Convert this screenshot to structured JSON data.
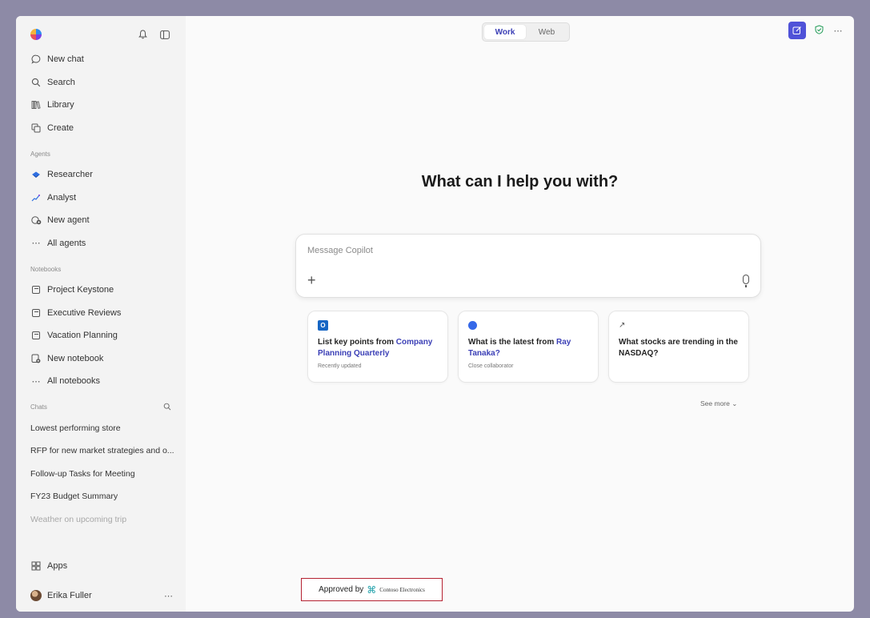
{
  "app": {
    "icons": {
      "logo": "copilot-logo",
      "notifications": "bell-icon",
      "sidebar_toggle": "sidebar-toggle-icon"
    }
  },
  "sidebar": {
    "nav": [
      {
        "label": "New chat",
        "icon": "chat-bubble-icon"
      },
      {
        "label": "Search",
        "icon": "search-icon"
      },
      {
        "label": "Library",
        "icon": "library-icon"
      },
      {
        "label": "Create",
        "icon": "create-icon"
      }
    ],
    "agents_heading": "Agents",
    "agents": [
      {
        "label": "Researcher",
        "icon": "researcher-icon"
      },
      {
        "label": "Analyst",
        "icon": "analyst-icon"
      },
      {
        "label": "New agent",
        "icon": "new-agent-icon"
      },
      {
        "label": "All agents",
        "icon": "ellipsis-icon"
      }
    ],
    "notebooks_heading": "Notebooks",
    "notebooks": [
      {
        "label": "Project Keystone",
        "icon": "notebook-icon"
      },
      {
        "label": "Executive Reviews",
        "icon": "notebook-icon"
      },
      {
        "label": "Vacation Planning",
        "icon": "notebook-icon"
      },
      {
        "label": "New notebook",
        "icon": "new-notebook-icon"
      },
      {
        "label": "All notebooks",
        "icon": "ellipsis-icon"
      }
    ],
    "chats_heading": "Chats",
    "chats": [
      "Lowest performing store",
      "RFP for new market strategies and o...",
      "Follow-up Tasks for Meeting",
      "FY23 Budget Summary",
      "Weather on upcoming trip"
    ],
    "apps_label": "Apps",
    "user_name": "Erika Fuller"
  },
  "header": {
    "toggle": [
      "Work",
      "Web"
    ],
    "active_toggle": "Work"
  },
  "main": {
    "headline": "What can I help you with?",
    "composer_placeholder": "Message Copilot",
    "cards": [
      {
        "text_plain": "List key points from ",
        "text_link": "Company Planning Quarterly",
        "text_tail": "",
        "sub": "Recently updated",
        "icon": "outlook-icon"
      },
      {
        "text_plain": "What is the latest from ",
        "text_link": "Ray Tanaka",
        "text_tail": "?",
        "sub": "Close collaborator",
        "icon": "teams-icon"
      },
      {
        "text_plain": "What stocks are trending in the NASDAQ?",
        "text_link": "",
        "text_tail": "",
        "sub": "",
        "icon": "trending-icon"
      }
    ],
    "see_more": "See more",
    "approved_by": "Approved by",
    "approved_brand": "Contoso Electronics"
  },
  "colors": {
    "accent": "#4f52d8",
    "link": "#3b3fb6",
    "approved_border": "#b52232",
    "frame": "#8d8aa6"
  }
}
